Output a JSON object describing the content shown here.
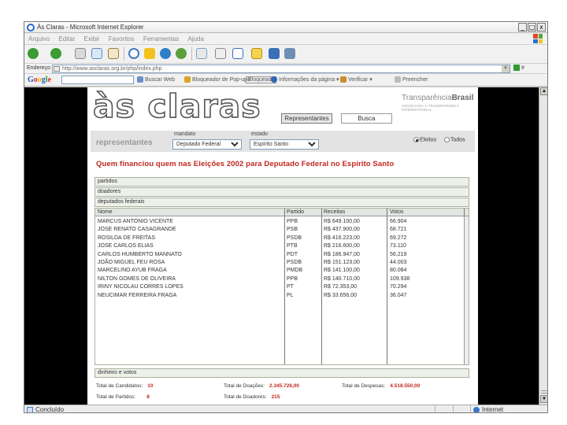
{
  "window": {
    "title": "Às Claras - Microsoft Internet Explorer",
    "buttons": [
      "_",
      "□",
      "x"
    ]
  },
  "menu": [
    "Arquivo",
    "Editar",
    "Exibir",
    "Favoritos",
    "Ferramentas",
    "Ajuda"
  ],
  "address": {
    "label": "Endereço",
    "url": "http://www.asclaras.org.br/php/index.php",
    "go": "Ir"
  },
  "google": {
    "logo": "Google",
    "items": [
      "Buscar Web",
      "Bloqueador de Pop-ups",
      "Bloqueado",
      "Informações da página",
      "Verificar",
      "Preencher"
    ]
  },
  "status": {
    "left": "Concluído",
    "zone": "Internet"
  },
  "site": {
    "logo": "às claras",
    "brand_a": "Transparência",
    "brand_b": "Brasil",
    "brand_sub": "ASSOCIADA À TRANSPARENCY INTERNATIONAL",
    "btn_representantes": "Representantes",
    "btn_busca": "Busca",
    "section": "representantes",
    "mandato_label": "mandato",
    "mandato_value": "Deputado Federal",
    "estado_label": "estado",
    "estado_value": "Espírito Santo",
    "radio_eleitos": "Eleitos",
    "radio_todos": "Todos",
    "headline": "Quem financiou quem nas Eleições 2002 para Deputado Federal no Espírito Santo",
    "sections": [
      "partidos",
      "doadores",
      "deputados federais"
    ],
    "footer_section": "dinheiro e votos",
    "columns": [
      "Nome",
      "Partido",
      "Receitas",
      "Votos"
    ],
    "rows": [
      [
        "MARCUS ANTONIO VICENTE",
        "PPB",
        "R$ 649.100,00",
        "66.904"
      ],
      [
        "JOSE RENATO CASAGRANDE",
        "PSB",
        "R$ 437.900,00",
        "68.721"
      ],
      [
        "ROSILDA DE FREITAS",
        "PSDB",
        "R$ 416.223,00",
        "69.272"
      ],
      [
        "JOSE CARLOS ELIAS",
        "PTB",
        "R$ 216.600,00",
        "73.110"
      ],
      [
        "CARLOS HUMBERTO MANNATO",
        "PDT",
        "R$ 186.947,00",
        "56.219"
      ],
      [
        "JOÃO MIGUEL FEU ROSA",
        "PSDB",
        "R$ 151.123,00",
        "44.003"
      ],
      [
        "MARCELINO AYUB FRAGA",
        "PMDB",
        "R$ 141.100,00",
        "80.084"
      ],
      [
        "NILTON GOMES DE OLIVEIRA",
        "PPB",
        "R$ 140.710,00",
        "109.938"
      ],
      [
        "IRINY NICOLAU CORRES LOPES",
        "PT",
        "R$ 72.353,00",
        "70.294"
      ],
      [
        "NEUCIMAR FERREIRA FRAGA",
        "PL",
        "R$ 33.656,00",
        "36.047"
      ]
    ],
    "totals": {
      "candidatos_label": "Total de Candidatos:",
      "candidatos": "10",
      "partidos_label": "Total de Partidos:",
      "partidos": "8",
      "doacoes_label": "Total de Doações:",
      "doacoes": "2.345.726,00",
      "doadores_label": "Total de Doadores:",
      "doadores": "215",
      "despesas_label": "Total de Despesas:",
      "despesas": "4.518.550,00"
    }
  },
  "colors": {
    "accent_red": "#c0271e",
    "band_gray": "#e3e3e3",
    "section_green": "#a8b29a"
  }
}
